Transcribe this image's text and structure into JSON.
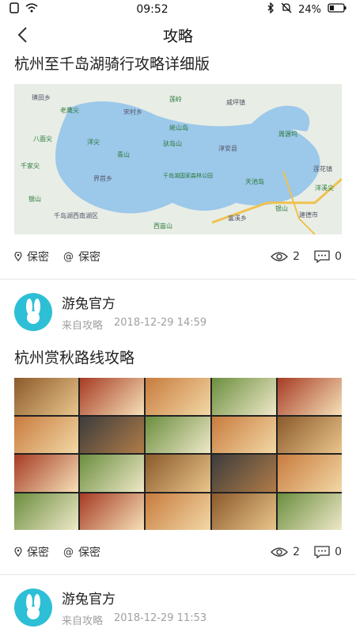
{
  "status": {
    "time": "09:52",
    "battery": "24%"
  },
  "nav": {
    "title": "攻略"
  },
  "posts": [
    {
      "title": "杭州至千岛湖骑行攻略详细版",
      "map_labels": {
        "l1": "璜田乡",
        "l2": "老鹰尖",
        "l3": "八面尖",
        "l4": "千家尖",
        "l5": "银山",
        "l6": "千岛湖西南湖区",
        "l7": "界首乡",
        "l8": "洋尖",
        "l9": "青山",
        "l10": "千岛湖国家森林公园",
        "l11": "姥山岛",
        "l12": "淳安县",
        "l13": "驮岛山",
        "l14": "莲岭",
        "l15": "周源坞",
        "l16": "天池岛",
        "l17": "银山",
        "l18": "建德市",
        "l19": "洋溪尖",
        "l20": "莲花镇",
        "l21": "富溪乡",
        "l22": "西亩山",
        "l23": "威坪镇",
        "l24": "宋村乡"
      },
      "privacy1": "保密",
      "privacy2": "保密",
      "views": "2",
      "comments": "0"
    },
    {
      "author": "游兔官方",
      "source": "来自攻略",
      "time": "2018-12-29 14:59",
      "title": "杭州赏秋路线攻略",
      "privacy1": "保密",
      "privacy2": "保密",
      "views": "2",
      "comments": "0"
    },
    {
      "author": "游兔官方",
      "source": "来自攻略",
      "time": "2018-12-29 11:53"
    }
  ],
  "colors": {
    "accent": "#2dbfd6",
    "water": "#9cc8ea",
    "land": "#e8ede6"
  }
}
